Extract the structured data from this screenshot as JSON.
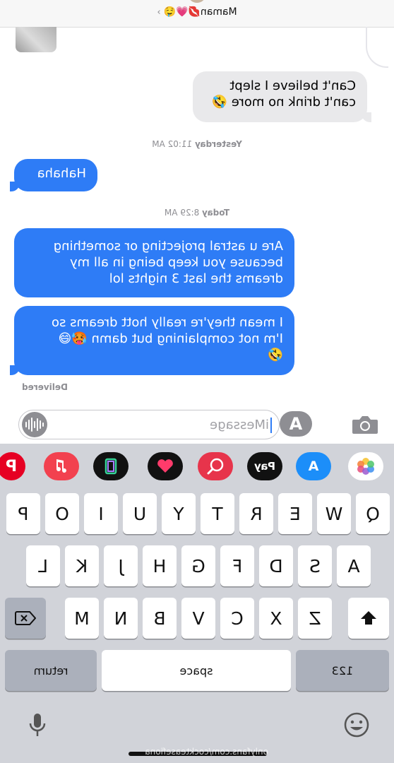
{
  "header": {
    "contact_name": "Maman",
    "contact_emojis": "💋💗🤤"
  },
  "messages": [
    {
      "type": "received",
      "lines": [
        "Can't believe I slept",
        "can't drink no more 🤣"
      ]
    },
    {
      "type": "timestamp",
      "day": "Yesterday",
      "time": "11:02 AM"
    },
    {
      "type": "sent",
      "lines": [
        "Hahaha"
      ]
    },
    {
      "type": "timestamp",
      "day": "Today",
      "time": "8:29 AM"
    },
    {
      "type": "sent",
      "lines": [
        "Are u astral projecting or something",
        "because you keep being in all my",
        "dreams the last 3 nights lol"
      ]
    },
    {
      "type": "sent",
      "lines": [
        "I mean they're really hott dreams so",
        "I'm not complaining but damn 🥵😅",
        "🤣"
      ]
    }
  ],
  "delivered_label": "Delivered",
  "input": {
    "placeholder": "iMessage"
  },
  "app_strip": [
    {
      "name": "photos",
      "icon": "photos-icon"
    },
    {
      "name": "app-store",
      "icon": "app-store-icon",
      "color": "#1c8ef9"
    },
    {
      "name": "apple-pay",
      "icon": "apple-pay-icon",
      "label": "Pay",
      "color": "#111111"
    },
    {
      "name": "images-search",
      "icon": "globe-search-icon",
      "color": "#e7344b"
    },
    {
      "name": "digital-touch",
      "icon": "heart-hand-icon",
      "color": "#111111"
    },
    {
      "name": "stickers",
      "icon": "sticker-frame-icon",
      "color": "#111111"
    },
    {
      "name": "music",
      "icon": "music-note-icon",
      "color": "#f2414f"
    },
    {
      "name": "pinterest",
      "icon": "pinterest-icon",
      "color": "#e60023"
    }
  ],
  "keyboard": {
    "row1": [
      "Q",
      "W",
      "E",
      "R",
      "T",
      "Y",
      "U",
      "I",
      "O",
      "P"
    ],
    "row2": [
      "A",
      "S",
      "D",
      "F",
      "G",
      "H",
      "J",
      "K",
      "L"
    ],
    "row3": [
      "Z",
      "X",
      "C",
      "V",
      "B",
      "N",
      "M"
    ],
    "numbers_label": "123",
    "space_label": "space",
    "return_label": "return"
  },
  "watermark": "onlyfans.com/cockteasefiona",
  "colors": {
    "sent_bubble": "#2e7cf6",
    "received_bubble": "#e9e9eb",
    "keyboard_bg": "#d1d3d9"
  }
}
